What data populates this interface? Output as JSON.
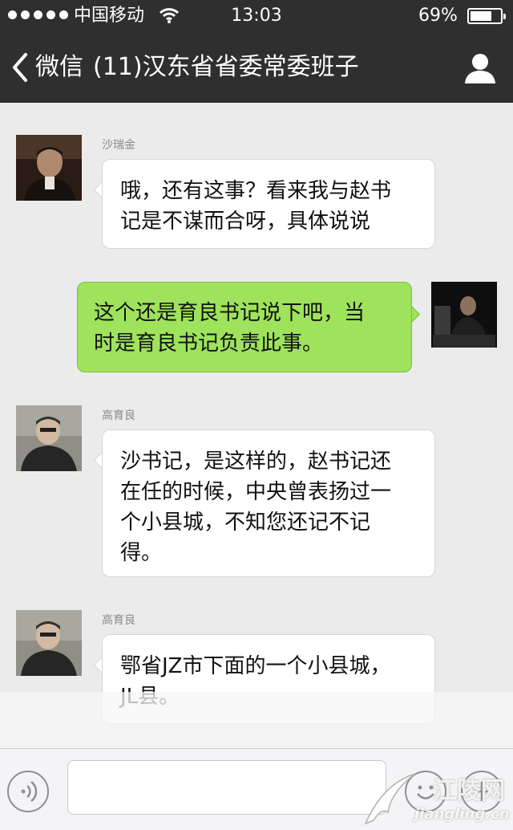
{
  "status_bar": {
    "carrier": "中国移动",
    "time": "13:03",
    "battery": "69%",
    "battery_level": 0.69
  },
  "nav": {
    "back_label": "微信",
    "title": "(11)汉东省省委常委班子"
  },
  "messages": [
    {
      "sender": "沙瑞金",
      "direction": "incoming",
      "lines": [
        "哦，还有这事？看来我与赵书",
        "记是不谋而合呀，具体说说"
      ]
    },
    {
      "sender": "",
      "direction": "outgoing",
      "lines": [
        "这个还是育良书记说下吧，当",
        "时是育良书记负责此事。"
      ]
    },
    {
      "sender": "高育良",
      "direction": "incoming",
      "lines": [
        "沙书记，是这样的，赵书记还",
        "在任的时候，中央曾表扬过一",
        "个小县城，不知您还记不记",
        "得。"
      ]
    },
    {
      "sender": "高育良",
      "direction": "incoming",
      "lines": [
        "鄂省JZ市下面的一个小县城，",
        "JL县。"
      ]
    }
  ],
  "input_bar": {
    "placeholder": "",
    "icons": [
      "voice-icon",
      "emoji-icon",
      "plus-icon"
    ]
  },
  "watermark": {
    "text": "江陵网",
    "url": "jiangling.cn"
  },
  "colors": {
    "nav_bg": "#2f2f2f",
    "chat_bg": "#ebebeb",
    "outgoing_bubble": "#9ee35b",
    "incoming_bubble": "#ffffff"
  }
}
